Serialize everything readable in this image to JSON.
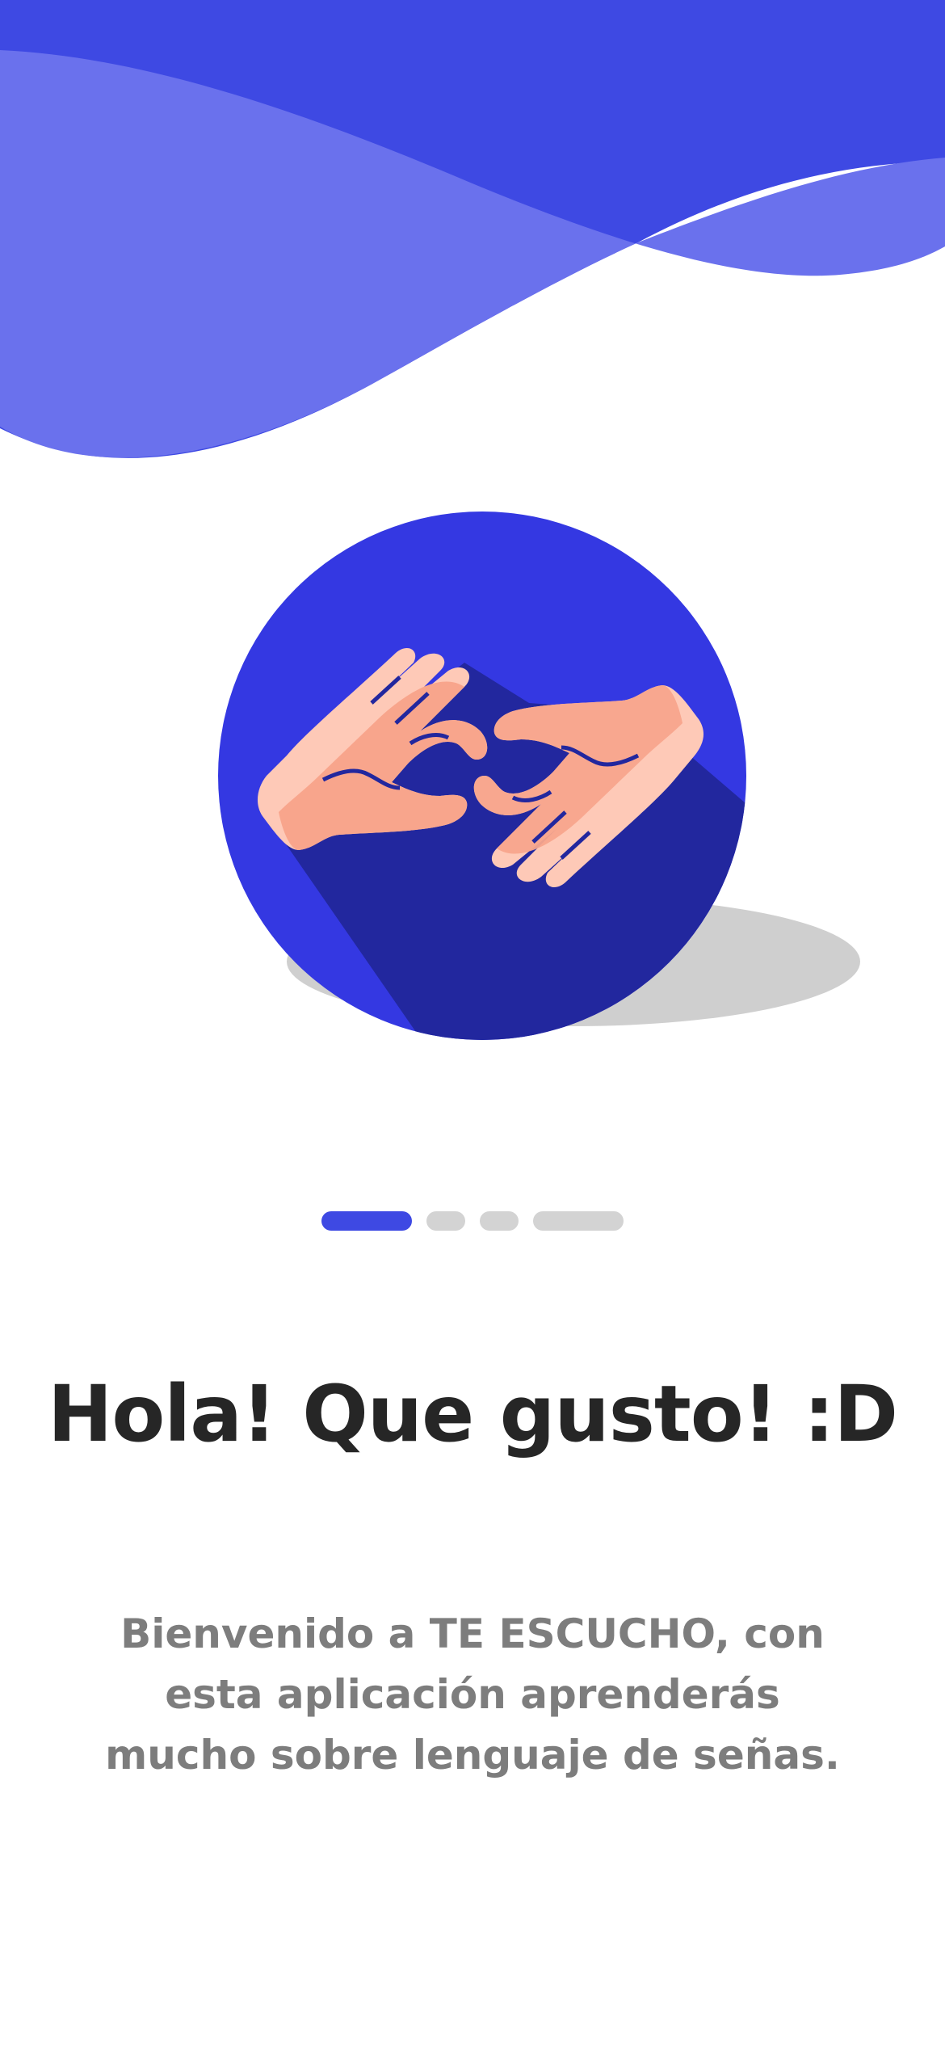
{
  "colors": {
    "primary": "#3e49e3",
    "wave_light": "#6a71ed",
    "circle": "#3438e2",
    "circle_shadow_inner": "#22279e",
    "ground_shadow": "#cfcfcf",
    "hand_light": "#fec9b7",
    "hand_dark": "#f8a58c",
    "dot_inactive": "#d3d3d3",
    "title_text": "#262626",
    "subtitle_text": "#7d7d7d"
  },
  "illustration": {
    "icon": "sign-language-hands-icon"
  },
  "pager": {
    "active_index": 0,
    "count": 4
  },
  "onboarding": {
    "title": "Hola! Que gusto! :D",
    "subtitle": "Bienvenido a TE ESCUCHO, con esta aplicación aprenderás mucho sobre lenguaje de señas."
  }
}
